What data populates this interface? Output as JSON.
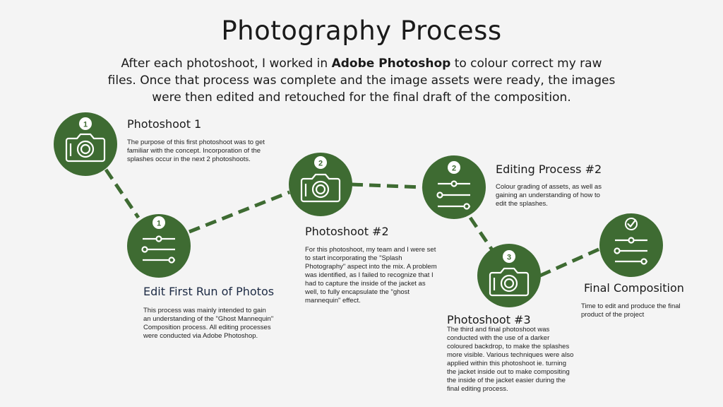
{
  "title": "Photography Process",
  "intro": {
    "before": "After each photoshoot, I worked in ",
    "emphasis": "Adobe Photoshop",
    "after": " to colour correct my raw files. Once that process was complete and the image assets were ready, the images were then edited and retouched for the final draft of the composition."
  },
  "colors": {
    "node_fill": "#3e6b32",
    "connector": "#3e6b32",
    "icon": "#ffffff"
  },
  "steps": [
    {
      "badge": "1",
      "icon": "camera-icon",
      "title": "Photoshoot 1",
      "desc": "The purpose of this first photoshoot was to get familiar with the concept. Incorporation of the splashes occur in the next 2 photoshoots."
    },
    {
      "badge": "1",
      "icon": "sliders-icon",
      "title": "Edit First Run of Photos",
      "desc": "This process was mainly intended to gain an understanding of the \"Ghost Mannequin\" Composition process. All editing processes were conducted via Adobe Photoshop."
    },
    {
      "badge": "2",
      "icon": "camera-icon",
      "title": "Photoshoot #2",
      "desc": "For this photoshoot, my team and I were set to start incorporating the \"Splash Photography\" aspect into the mix. A problem was identified, as I failed to recognize that I had to capture the inside of the jacket as well, to fully encapsulate the \"ghost mannequin\" effect."
    },
    {
      "badge": "2",
      "icon": "sliders-icon",
      "title": "Editing Process #2",
      "desc": "Colour grading of assets, as well as gaining an understanding of how to edit the splashes."
    },
    {
      "badge": "3",
      "icon": "camera-icon",
      "title": "Photoshoot #3",
      "desc": "The third and final photoshoot was conducted with the use of a darker coloured backdrop, to make the splashes more visible. Various techniques were also applied within this photoshoot ie. turning the jacket inside out to make compositing the inside of the jacket easier during the final editing process."
    },
    {
      "badge": "",
      "icon": "check-sliders-icon",
      "title": "Final Composition",
      "desc": "Time to edit and produce the final product of the project"
    }
  ]
}
